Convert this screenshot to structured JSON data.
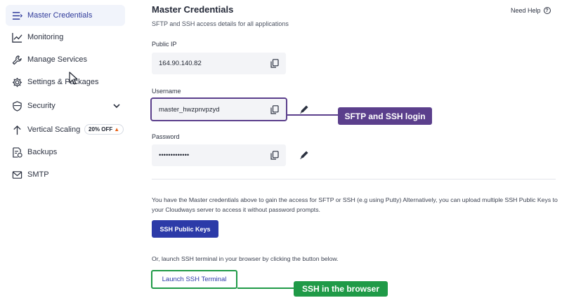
{
  "sidebar": {
    "items": [
      {
        "label": "Master Credentials",
        "icon": "list-icon",
        "active": true
      },
      {
        "label": "Monitoring",
        "icon": "chart-line-icon"
      },
      {
        "label": "Manage Services",
        "icon": "wrench-icon"
      },
      {
        "label": "Settings & Packages",
        "icon": "gear-icon"
      },
      {
        "label": "Security",
        "icon": "shield-icon"
      },
      {
        "label": "Vertical Scaling",
        "icon": "arrow-up-icon",
        "badge": "20% OFF"
      },
      {
        "label": "Backups",
        "icon": "backup-icon"
      },
      {
        "label": "SMTP",
        "icon": "mail-icon"
      }
    ]
  },
  "header": {
    "title": "Master Credentials",
    "subtitle": "SFTP and SSH access details for all applications",
    "help": "Need Help"
  },
  "fields": {
    "public_ip": {
      "label": "Public IP",
      "value": "164.90.140.82"
    },
    "username": {
      "label": "Username",
      "value": "master_hwzpnvpzyd"
    },
    "password": {
      "label": "Password",
      "value": "•••••••••••••"
    }
  },
  "annotations": {
    "login": "SFTP and SSH login",
    "browser": "SSH in the browser"
  },
  "info_text": "You have the Master credentials above to gain the access for SFTP or SSH (e.g using Putty) Alternatively, you can upload multiple SSH Public Keys to your Cloudways server to access it without password prompts.",
  "ssh_keys_button": "SSH Public Keys",
  "terminal_text": "Or, launch SSH terminal in your browser by clicking the button below.",
  "launch_button": "Launch SSH Terminal",
  "colors": {
    "accent": "#2c3aa8",
    "highlight_purple": "#5b3f8c",
    "highlight_green": "#1f9a47",
    "active_bg": "#f1f4fb"
  }
}
